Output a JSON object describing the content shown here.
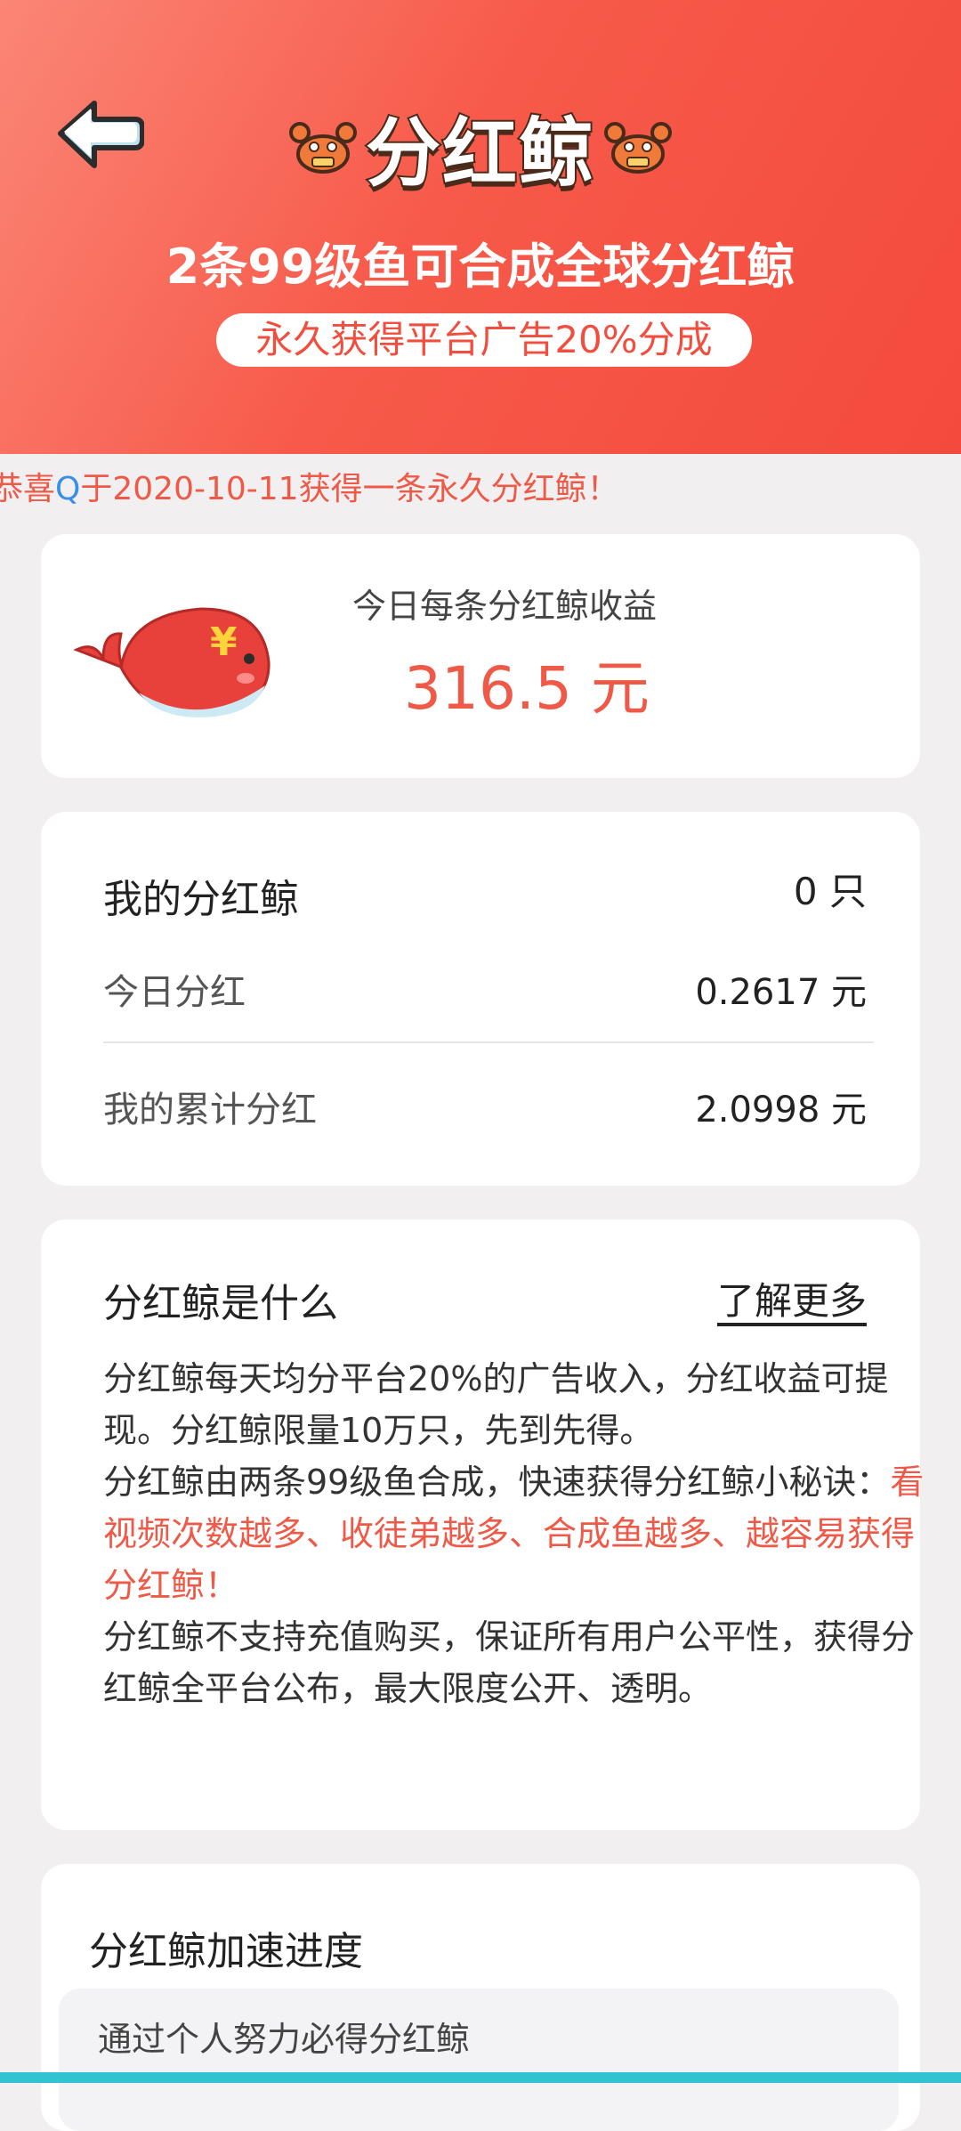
{
  "header": {
    "title": "分红鲸",
    "subtitle": "2条99级鱼可合成全球分红鲸",
    "pill_text": "永久获得平台广告20%分成"
  },
  "ticker": {
    "prefix": "恭喜",
    "user": "Q",
    "suffix": "于2020-10-11获得一条永久分红鲸！"
  },
  "earnings_card": {
    "label": "今日每条分红鲸收益",
    "value": "316.5 元",
    "icon": "whale-icon"
  },
  "my_whale_card": {
    "rows": [
      {
        "label": "我的分红鲸",
        "value": "0 只"
      },
      {
        "label": "今日分红",
        "value": "0.2617 元"
      },
      {
        "label": "我的累计分红",
        "value": "2.0998 元"
      }
    ]
  },
  "about_card": {
    "title": "分红鲸是什么",
    "link": "了解更多",
    "p1": "分红鲸每天均分平台20%的广告收入，分红收益可提现。分红鲸限量10万只，先到先得。",
    "p2_a": "分红鲸由两条99级鱼合成，快速获得分红鲸小秘诀：",
    "p2_b": "看视频次数越多、收徒弟越多、合成鱼越多、越容易获得分红鲸！",
    "p3": "分红鲸不支持充值购买，保证所有用户公平性，获得分红鲸全平台公布，最大限度公开、透明。"
  },
  "progress_card": {
    "title": "分红鲸加速进度",
    "box_text": "通过个人努力必得分红鲸"
  },
  "colors": {
    "accent": "#ef5a48",
    "header_start": "#fb8676",
    "header_end": "#f34a3d",
    "link_blue": "#3a8ee6"
  }
}
